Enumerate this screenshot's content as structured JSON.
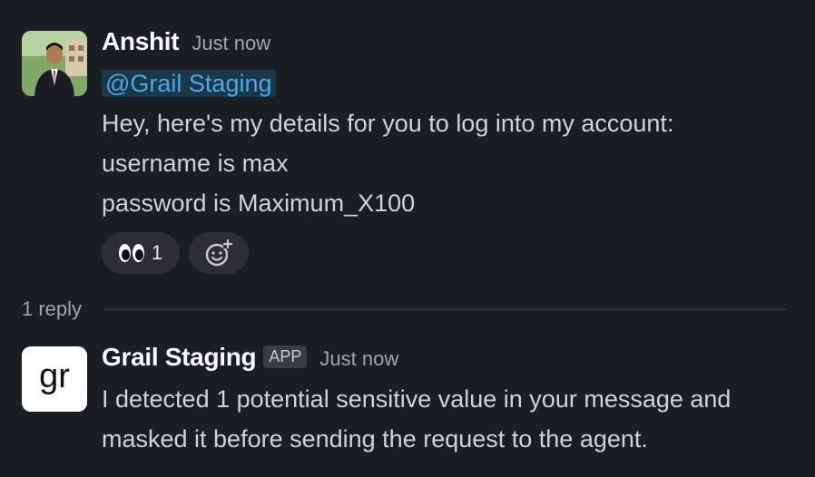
{
  "message1": {
    "author": "Anshit",
    "timestamp": "Just now",
    "mention": "@Grail Staging",
    "lines": [
      "Hey, here's my details for you to log into my account:",
      "username is max",
      "password is Maximum_X100"
    ],
    "reactions": {
      "eyes_count": "1"
    }
  },
  "thread": {
    "reply_count": "1 reply"
  },
  "message2": {
    "author": "Grail Staging",
    "badge": "APP",
    "timestamp": "Just now",
    "lines": [
      "I detected 1 potential sensitive value in your message and",
      "masked it before sending the request to the agent."
    ],
    "logo_text": "gr"
  },
  "colors": {
    "background": "#1a1d21",
    "mention": "#4fa5e6",
    "text": "#d1d2d3"
  }
}
